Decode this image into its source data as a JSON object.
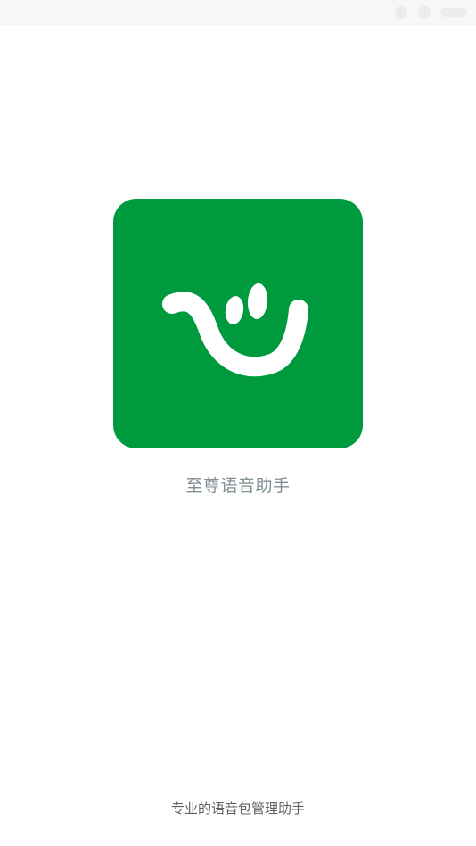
{
  "status_bar": {
    "icons": [
      "signal-icon",
      "wifi-icon",
      "battery-icon"
    ]
  },
  "app": {
    "name": "至尊语音助手",
    "tagline": "专业的语音包管理助手",
    "icon_name": "smiley-logo-icon",
    "brand_color": "#009a3e"
  },
  "colors": {
    "background": "#ffffff",
    "app_name_text": "#7f8f93",
    "tagline_text": "#5f5f5f"
  }
}
